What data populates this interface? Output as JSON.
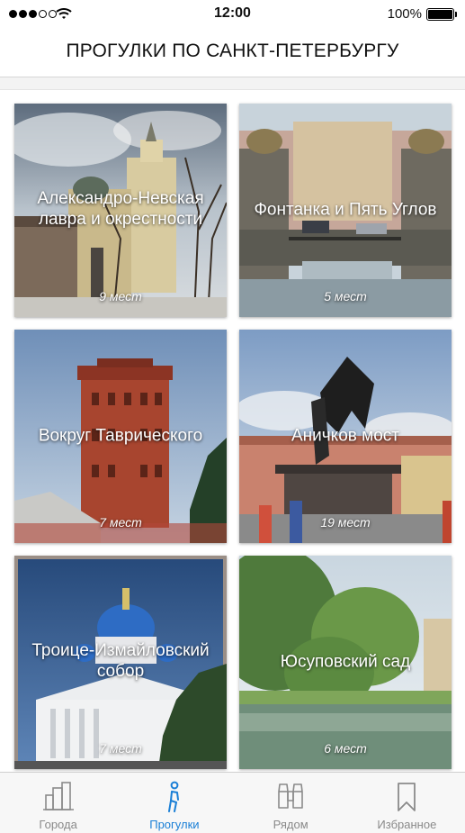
{
  "status_bar": {
    "time": "12:00",
    "battery": "100%"
  },
  "nav": {
    "title": "ПРОГУЛКИ ПО САНКТ-ПЕТЕРБУРГУ"
  },
  "walks": [
    {
      "title": "Александро-Невская лавра и окрестности",
      "count": "9 мест"
    },
    {
      "title": "Фонтанка и Пять Углов",
      "count": "5 мест"
    },
    {
      "title": "Вокруг Таврического",
      "count": "7 мест"
    },
    {
      "title": "Аничков мост",
      "count": "19 мест"
    },
    {
      "title": "Троице-Измайловский собор",
      "count": "7 мест"
    },
    {
      "title": "Юсуповский сад",
      "count": "6 мест"
    }
  ],
  "tabs": [
    {
      "label": "Города",
      "icon": "city-icon"
    },
    {
      "label": "Прогулки",
      "icon": "walker-icon"
    },
    {
      "label": "Рядом",
      "icon": "binoculars-icon"
    },
    {
      "label": "Избранное",
      "icon": "bookmark-icon"
    }
  ],
  "colors": {
    "accent": "#1a7fd6",
    "inactive": "#8a8a8a"
  },
  "active_tab": "Прогулки"
}
